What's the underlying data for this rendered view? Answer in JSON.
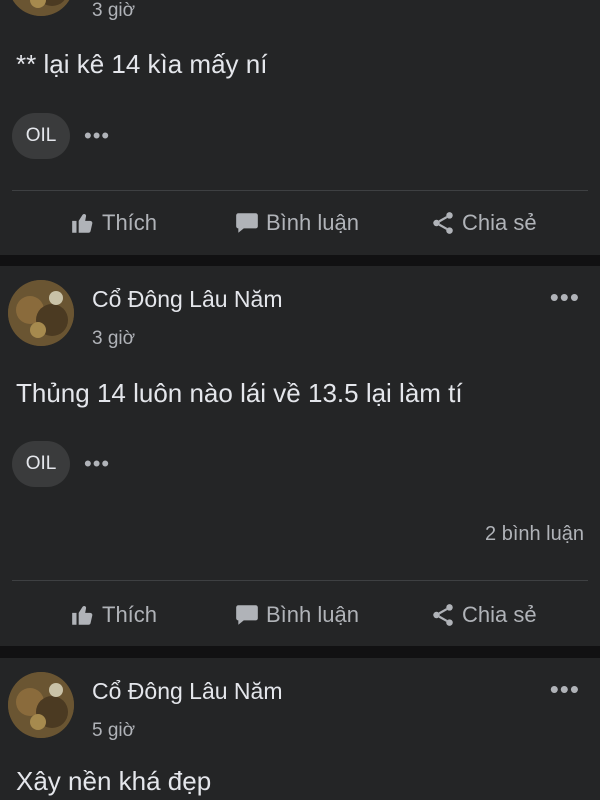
{
  "posts": [
    {
      "time": "3 giờ",
      "text": "** lại kê 14 kìa mấy ní",
      "tag": "OIL",
      "tag_more": "•••",
      "actions": {
        "like": "Thích",
        "comment": "Bình luận",
        "share": "Chia sẻ"
      }
    },
    {
      "author": "Cổ Đông Lâu Năm",
      "time": "3 giờ",
      "more": "•••",
      "text": "Thủng 14 luôn nào lái về 13.5 lại làm tí",
      "tag": "OIL",
      "tag_more": "•••",
      "comment_count": "2 bình luận",
      "actions": {
        "like": "Thích",
        "comment": "Bình luận",
        "share": "Chia sẻ"
      }
    },
    {
      "author": "Cổ Đông Lâu Năm",
      "time": "5 giờ",
      "more": "•••",
      "text": "Xây nền khá đẹp"
    }
  ],
  "icons": [
    "thumbs-up-icon",
    "comment-icon",
    "share-icon",
    "more-icon"
  ],
  "colors": {
    "background": "#111112",
    "card": "#242526",
    "text": "#e4e6eb",
    "muted": "#b0b3b8"
  }
}
